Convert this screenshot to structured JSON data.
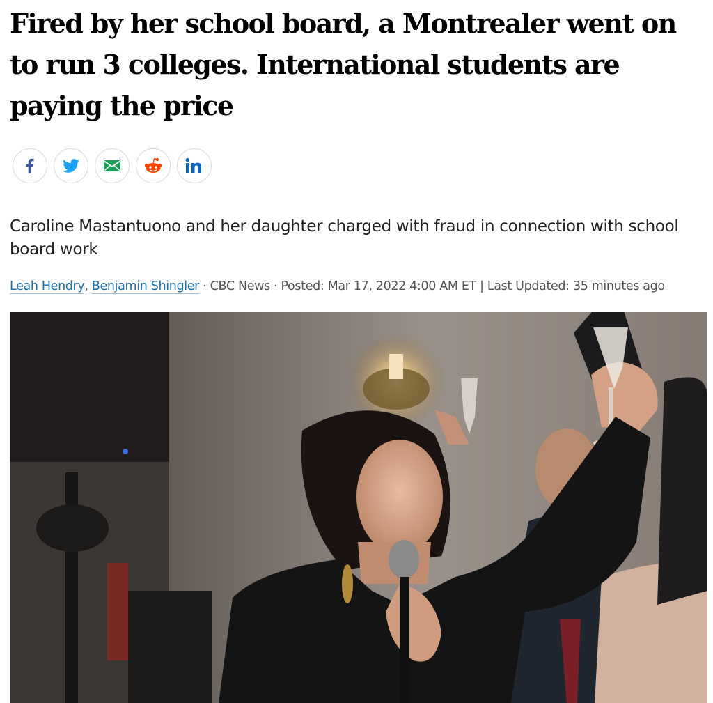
{
  "article": {
    "headline": "Fired by her school board, a Montrealer went on to run 3 colleges. International students are paying the price",
    "deck": "Caroline Mastantuono and her daughter charged with fraud in connection with school board work",
    "byline": {
      "authors": [
        "Leah Hendry",
        "Benjamin Shingler"
      ],
      "author_separator": ", ",
      "source": " · CBC News · Posted: Mar 17, 2022 4:00 AM ET | Last Updated: 35 minutes ago"
    }
  },
  "share": [
    {
      "icon": "facebook-icon",
      "color": "#3b5998"
    },
    {
      "icon": "twitter-icon",
      "color": "#1da1f2"
    },
    {
      "icon": "email-icon",
      "color": "#1e9e58"
    },
    {
      "icon": "reddit-icon",
      "color": "#ff4500"
    },
    {
      "icon": "linkedin-icon",
      "color": "#0a66c2"
    }
  ]
}
